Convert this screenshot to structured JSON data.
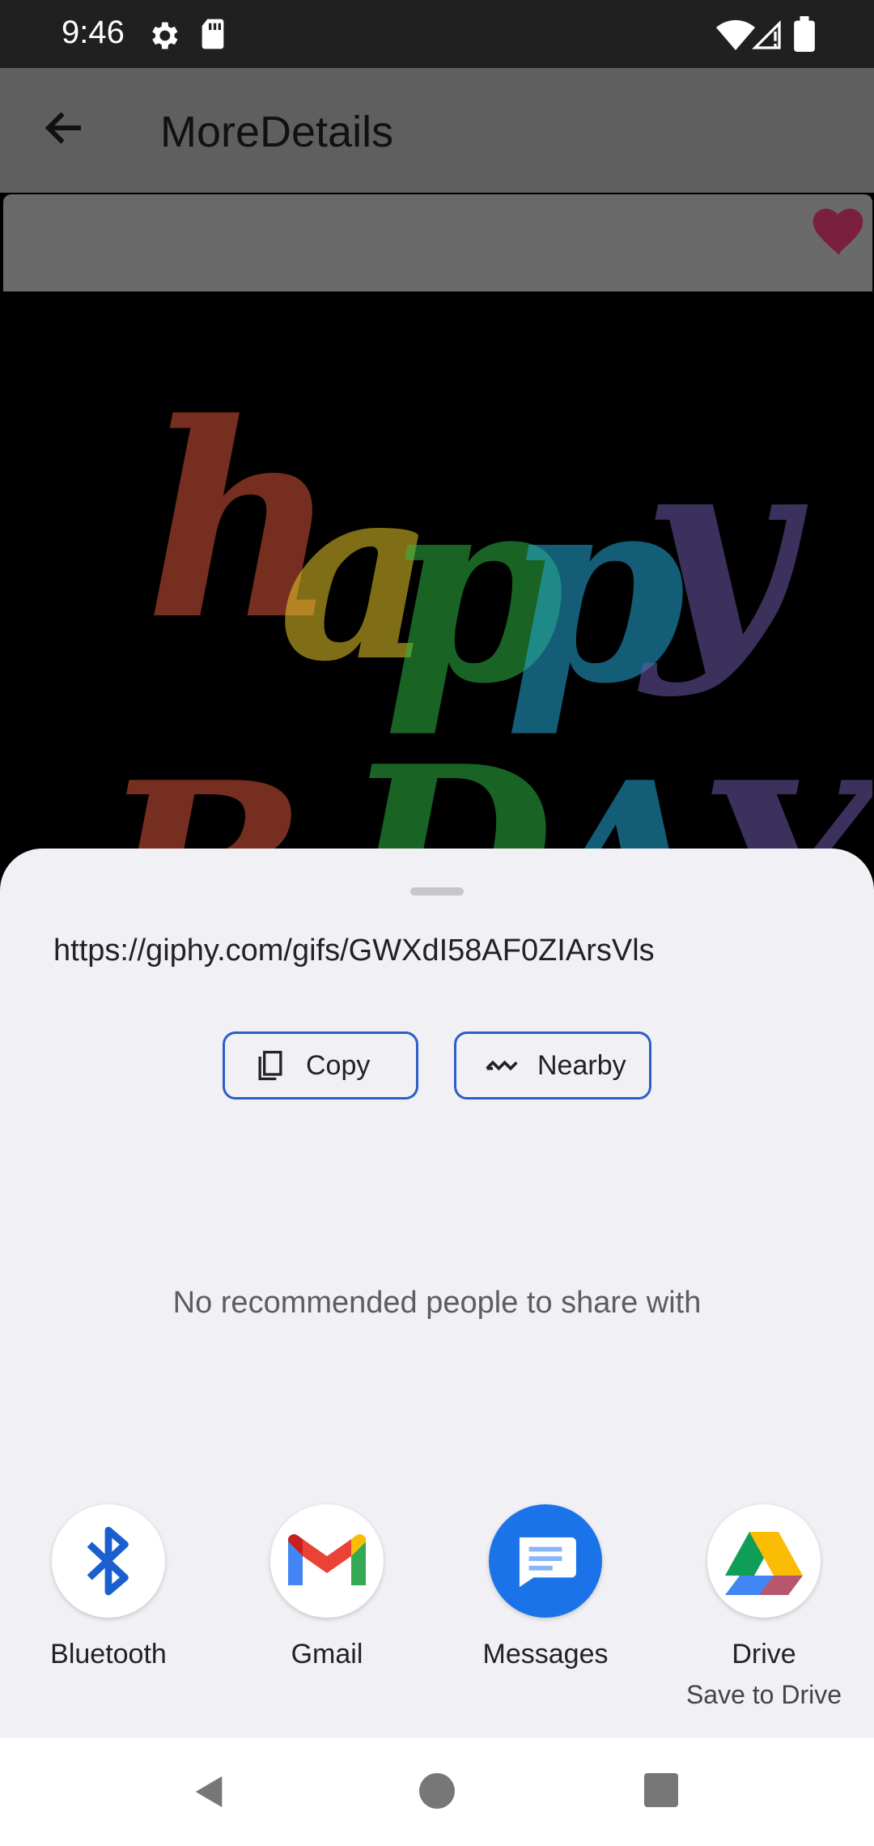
{
  "status_bar": {
    "time": "9:46"
  },
  "app_bar": {
    "title": "MoreDetails"
  },
  "media": {
    "gif_letters": [
      "h",
      "a",
      "p",
      "p",
      "y",
      "B",
      "D",
      "A",
      "Y"
    ]
  },
  "share_sheet": {
    "url": "https://giphy.com/gifs/GWXdI58AF0ZIArsVls",
    "copy_label": "Copy",
    "nearby_label": "Nearby",
    "empty_people": "No recommended people to share with",
    "targets": [
      {
        "name": "Bluetooth",
        "subtitle": ""
      },
      {
        "name": "Gmail",
        "subtitle": ""
      },
      {
        "name": "Messages",
        "subtitle": ""
      },
      {
        "name": "Drive",
        "subtitle": "Save to Drive"
      }
    ]
  },
  "colors": {
    "accent_border": "#2a5ec8",
    "heart": "#7a1f3d",
    "messages_blue": "#1a73e8",
    "bluetooth_blue": "#1a5fd0"
  },
  "icons": [
    "settings-icon",
    "sd-card-icon",
    "wifi-icon",
    "signal-icon",
    "battery-icon",
    "back-arrow-icon",
    "heart-icon",
    "copy-icon",
    "nearby-icon",
    "bluetooth-icon",
    "gmail-icon",
    "messages-icon",
    "drive-icon"
  ]
}
